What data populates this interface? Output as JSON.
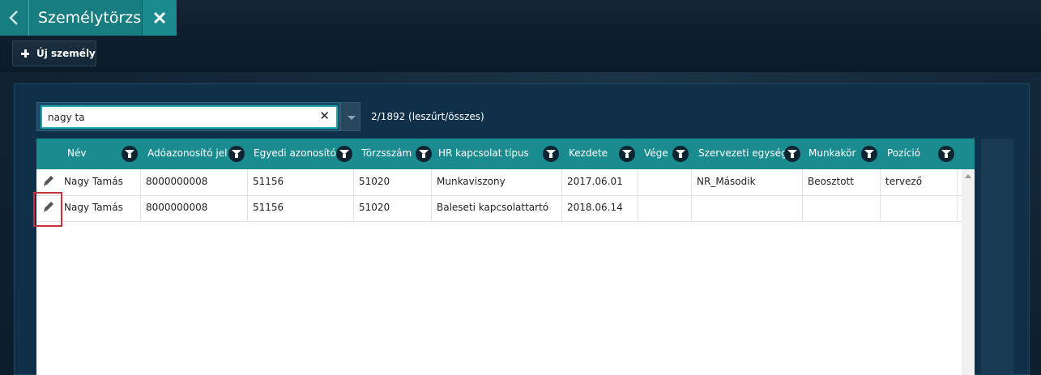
{
  "window": {
    "title": "Személytörzs"
  },
  "toolbar": {
    "new_label": "Új személy"
  },
  "search": {
    "value": "nagy ta",
    "counter": "2/1892 (leszűrt/összes)"
  },
  "grid": {
    "columns": [
      "Név",
      "Adóazonosító jel",
      "Egyedi azonosító",
      "Törzsszám",
      "HR kapcsolat típus",
      "Kezdete",
      "Vége",
      "Szervezeti egység",
      "Munkakör",
      "Pozíció"
    ],
    "rows": [
      [
        "Nagy Tamás",
        "8000000008",
        "51156",
        "51020",
        "Munkaviszony",
        "2017.06.01",
        "",
        "NR_Második",
        "Beosztott",
        "tervező"
      ],
      [
        "Nagy Tamás",
        "8000000008",
        "51156",
        "51020",
        "Baleseti kapcsolattartó",
        "2018.06.14",
        "",
        "",
        "",
        ""
      ]
    ]
  },
  "colors": {
    "tab_teal": "#177d80",
    "header_teal": "#1a8c90",
    "highlight_red": "#c9303a"
  },
  "icons": {
    "back": "chevron-left-icon",
    "close": "close-icon",
    "add": "plus-icon",
    "filter": "filter-icon",
    "edit": "pencil-icon"
  }
}
